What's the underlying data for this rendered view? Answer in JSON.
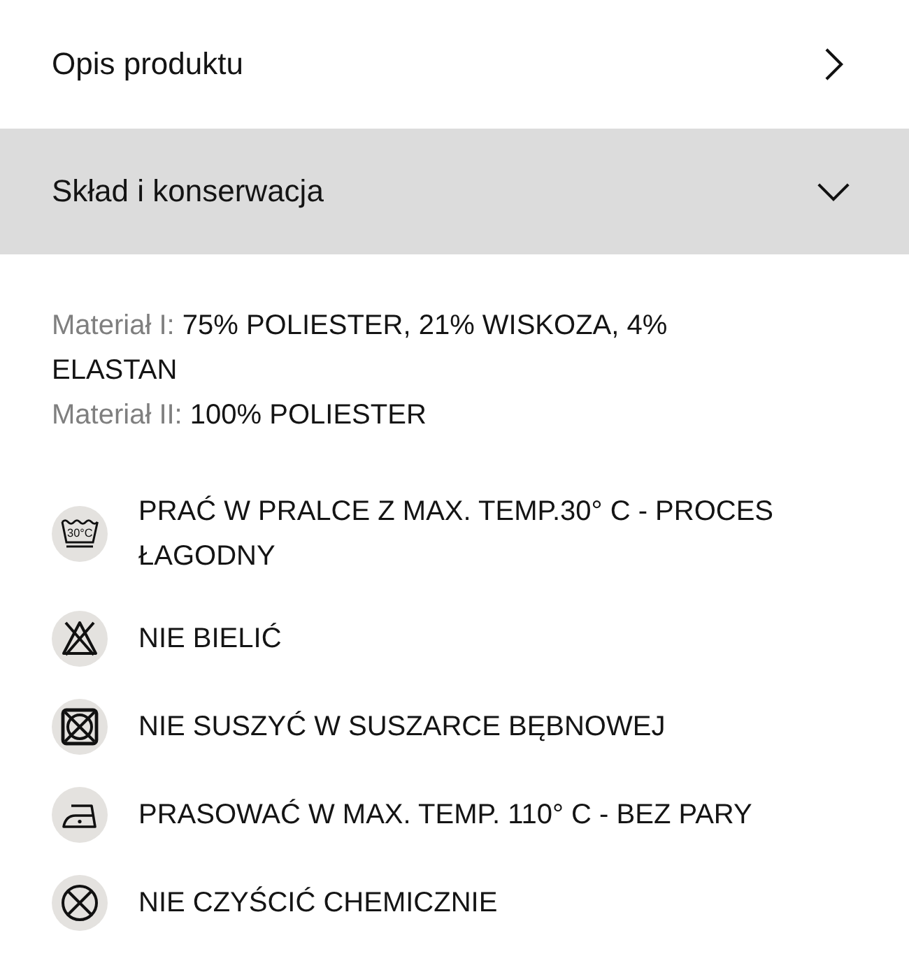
{
  "sections": [
    {
      "title": "Opis produktu",
      "expanded": false
    },
    {
      "title": "Skład i konserwacja",
      "expanded": true,
      "materials": [
        {
          "label": "Materiał I:",
          "value": "75% POLIESTER, 21% WISKOZA, 4% ELASTAN"
        },
        {
          "label": "Materiał II:",
          "value": "100% POLIESTER"
        }
      ],
      "care": [
        {
          "kind": "wash",
          "symbol_text": "30°C",
          "text": "PRAĆ W PRALCE Z MAX. TEMP.30° C - PROCES ŁAGODNY"
        },
        {
          "kind": "bleach",
          "text": "NIE BIELIĆ"
        },
        {
          "kind": "tumble_dry",
          "text": "NIE SUSZYĆ W SUSZARCE BĘBNOWEJ"
        },
        {
          "kind": "iron",
          "text": "PRASOWAĆ W MAX. TEMP. 110° C - BEZ PARY"
        },
        {
          "kind": "dry_clean",
          "text": "NIE CZYŚCIĆ CHEMICZNIE"
        }
      ]
    }
  ]
}
